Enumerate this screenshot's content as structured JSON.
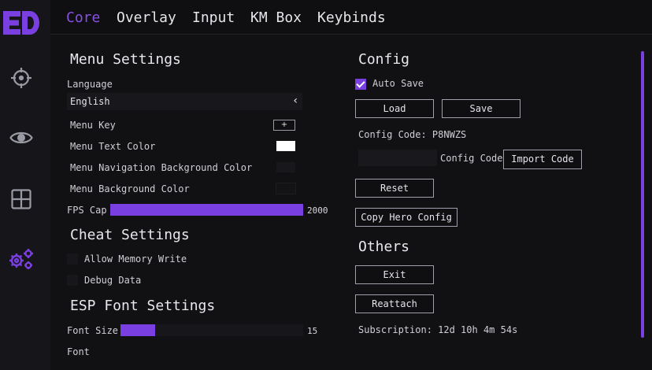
{
  "colors": {
    "accent": "#7a3fe0",
    "active_tab": "#8a4fe6",
    "sidebar_bg": "#16161a",
    "main_bg": "#111114"
  },
  "logo": {
    "text": "ED"
  },
  "sidebar": {
    "items": [
      {
        "icon": "crosshair-icon"
      },
      {
        "icon": "eye-icon"
      },
      {
        "icon": "grid-icon"
      },
      {
        "icon": "gears-icon",
        "active": true
      }
    ]
  },
  "tabs": [
    {
      "label": "Core",
      "active": true
    },
    {
      "label": "Overlay"
    },
    {
      "label": "Input"
    },
    {
      "label": "KM Box"
    },
    {
      "label": "Keybinds"
    }
  ],
  "menu_settings": {
    "title": "Menu Settings",
    "language_label": "Language",
    "language_value": "English",
    "menu_key_label": "Menu Key",
    "menu_key_value": "+",
    "text_color_label": "Menu Text Color",
    "text_color_value": "#ffffff",
    "nav_bg_label": "Menu Navigation Background Color",
    "nav_bg_value": "#18181c",
    "bg_label": "Menu Background Color",
    "bg_value": "#131316",
    "fps_label": "FPS Cap",
    "fps_value": "2000",
    "fps_fill_fraction": 1.0
  },
  "cheat_settings": {
    "title": "Cheat Settings",
    "allow_memory_write_label": "Allow Memory Write",
    "allow_memory_write": false,
    "debug_data_label": "Debug Data",
    "debug_data": false
  },
  "esp_font_settings": {
    "title": "ESP Font Settings",
    "font_size_label": "Font Size",
    "font_size_value": "15",
    "font_size_fill_fraction": 0.19,
    "font_label": "Font"
  },
  "config": {
    "title": "Config",
    "auto_save_label": "Auto Save",
    "auto_save": true,
    "load_label": "Load",
    "save_label": "Save",
    "config_code_text": "Config Code: P8NWZS",
    "code_input_label": "Config Code",
    "import_label": "Import Code",
    "reset_label": "Reset",
    "copy_hero_label": "Copy Hero Config"
  },
  "others": {
    "title": "Others",
    "exit_label": "Exit",
    "reattach_label": "Reattach",
    "subscription_text": "Subscription: 12d 10h 4m 54s"
  }
}
